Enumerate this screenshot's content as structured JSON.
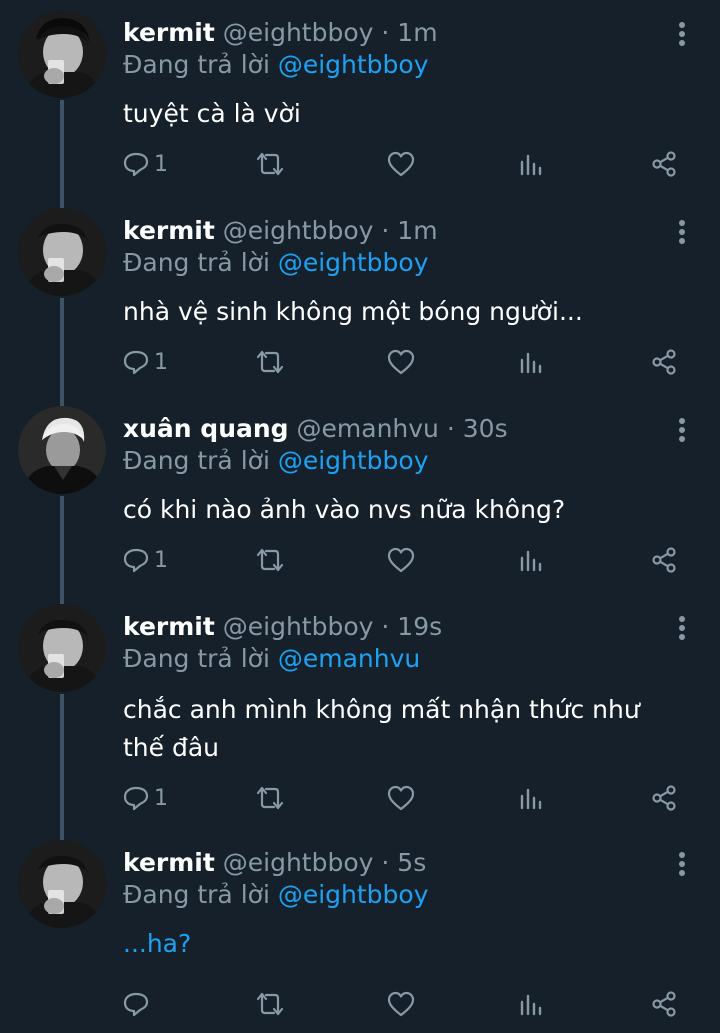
{
  "reply_prefix": "Đang trả lời",
  "tweets": [
    {
      "name": "kermit",
      "handle": "@eightbboy",
      "time": "1m",
      "reply_to": "@eightbboy",
      "text": "tuyệt cà là vời",
      "reply_count": "1",
      "avatar": "kermit-avatar"
    },
    {
      "name": "kermit",
      "handle": "@eightbboy",
      "time": "1m",
      "reply_to": "@eightbboy",
      "text": "nhà vệ sinh không một bóng người...",
      "reply_count": "1",
      "avatar": "kermit-avatar"
    },
    {
      "name": "xuân quang",
      "handle": "@emanhvu",
      "time": "30s",
      "reply_to": "@eightbboy",
      "text": "có khi nào ảnh vào nvs nữa không?",
      "reply_count": "1",
      "avatar": "xuan-quang-avatar"
    },
    {
      "name": "kermit",
      "handle": "@eightbboy",
      "time": "19s",
      "reply_to": "@emanhvu",
      "text": "chắc anh mình không mất nhận thức như thế đâu",
      "reply_count": "1",
      "avatar": "kermit-avatar"
    },
    {
      "name": "kermit",
      "handle": "@eightbboy",
      "time": "5s",
      "reply_to": "@eightbboy",
      "text": "...ha?",
      "reply_count": "",
      "avatar": "kermit-avatar"
    }
  ],
  "colors": {
    "background": "#15202b",
    "secondary_text": "#8899a6",
    "accent": "#1da1f2",
    "thread_line": "#3d5466"
  },
  "icons": [
    "more-vertical-icon",
    "reply-icon",
    "retweet-icon",
    "like-icon",
    "analytics-icon",
    "share-icon"
  ]
}
